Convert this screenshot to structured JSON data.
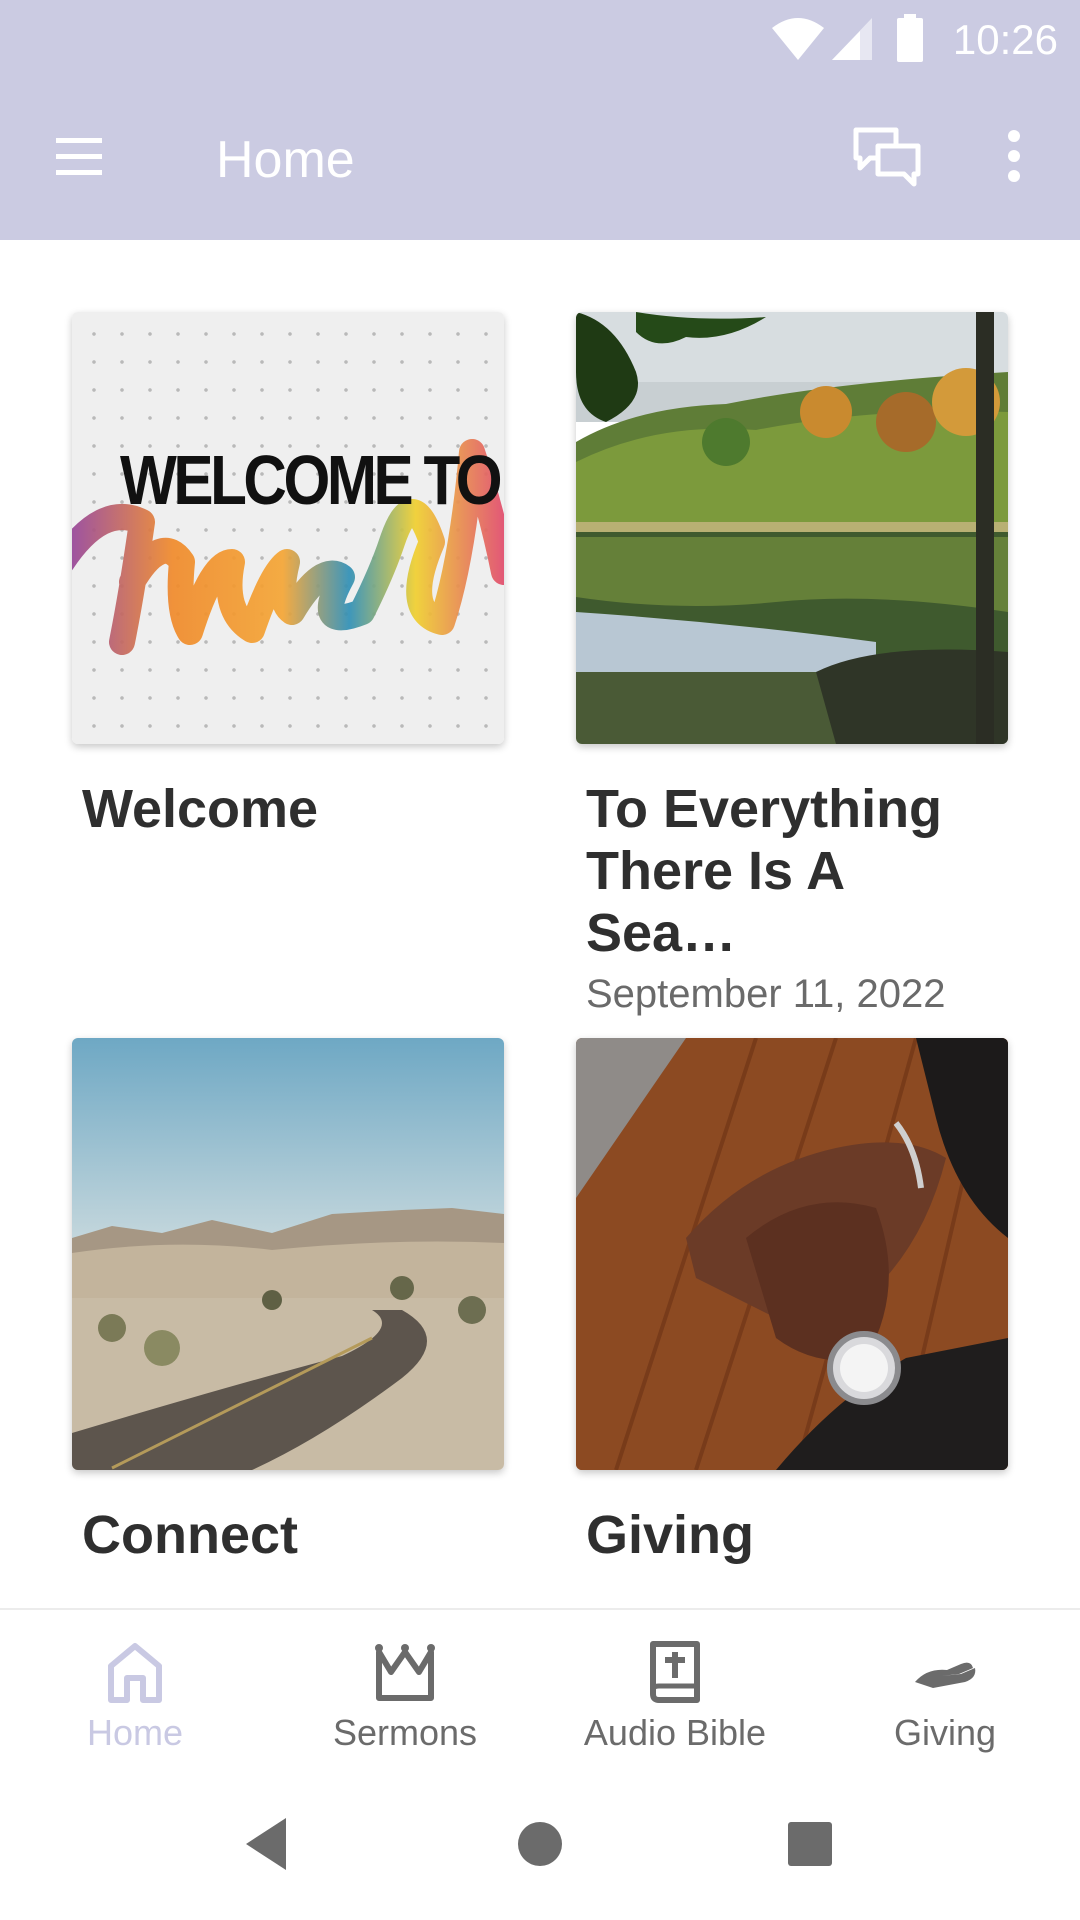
{
  "status_bar": {
    "time": "10:26",
    "icons": [
      "wifi-icon",
      "cell-signal-icon",
      "battery-icon"
    ]
  },
  "app_bar": {
    "title": "Home",
    "menu_icon": "hamburger-menu-icon",
    "chat_icon": "chat-bubbles-icon",
    "more_icon": "more-vert-icon"
  },
  "cards": [
    {
      "title": "Welcome",
      "subtitle": "",
      "image_heading": "WELCOME TO",
      "image_script": "church"
    },
    {
      "title": "To Everything There Is A Sea…",
      "subtitle": "September 11, 2022",
      "image": "lake-forest-photo"
    },
    {
      "title": "Connect",
      "subtitle": "",
      "image": "desert-road-photo"
    },
    {
      "title": "Giving",
      "subtitle": "",
      "image": "hands-watch-photo"
    }
  ],
  "bottom_nav": {
    "items": [
      {
        "label": "Home",
        "icon": "home-icon",
        "active": true
      },
      {
        "label": "Sermons",
        "icon": "crown-icon",
        "active": false
      },
      {
        "label": "Audio Bible",
        "icon": "bible-icon",
        "active": false
      },
      {
        "label": "Giving",
        "icon": "giving-hand-icon",
        "active": false
      }
    ]
  },
  "colors": {
    "app_bar": "#cbcbe2",
    "active_nav": "#c9c9e3",
    "inactive_nav": "#6b6b6b",
    "title_text": "#2f2f2f"
  }
}
